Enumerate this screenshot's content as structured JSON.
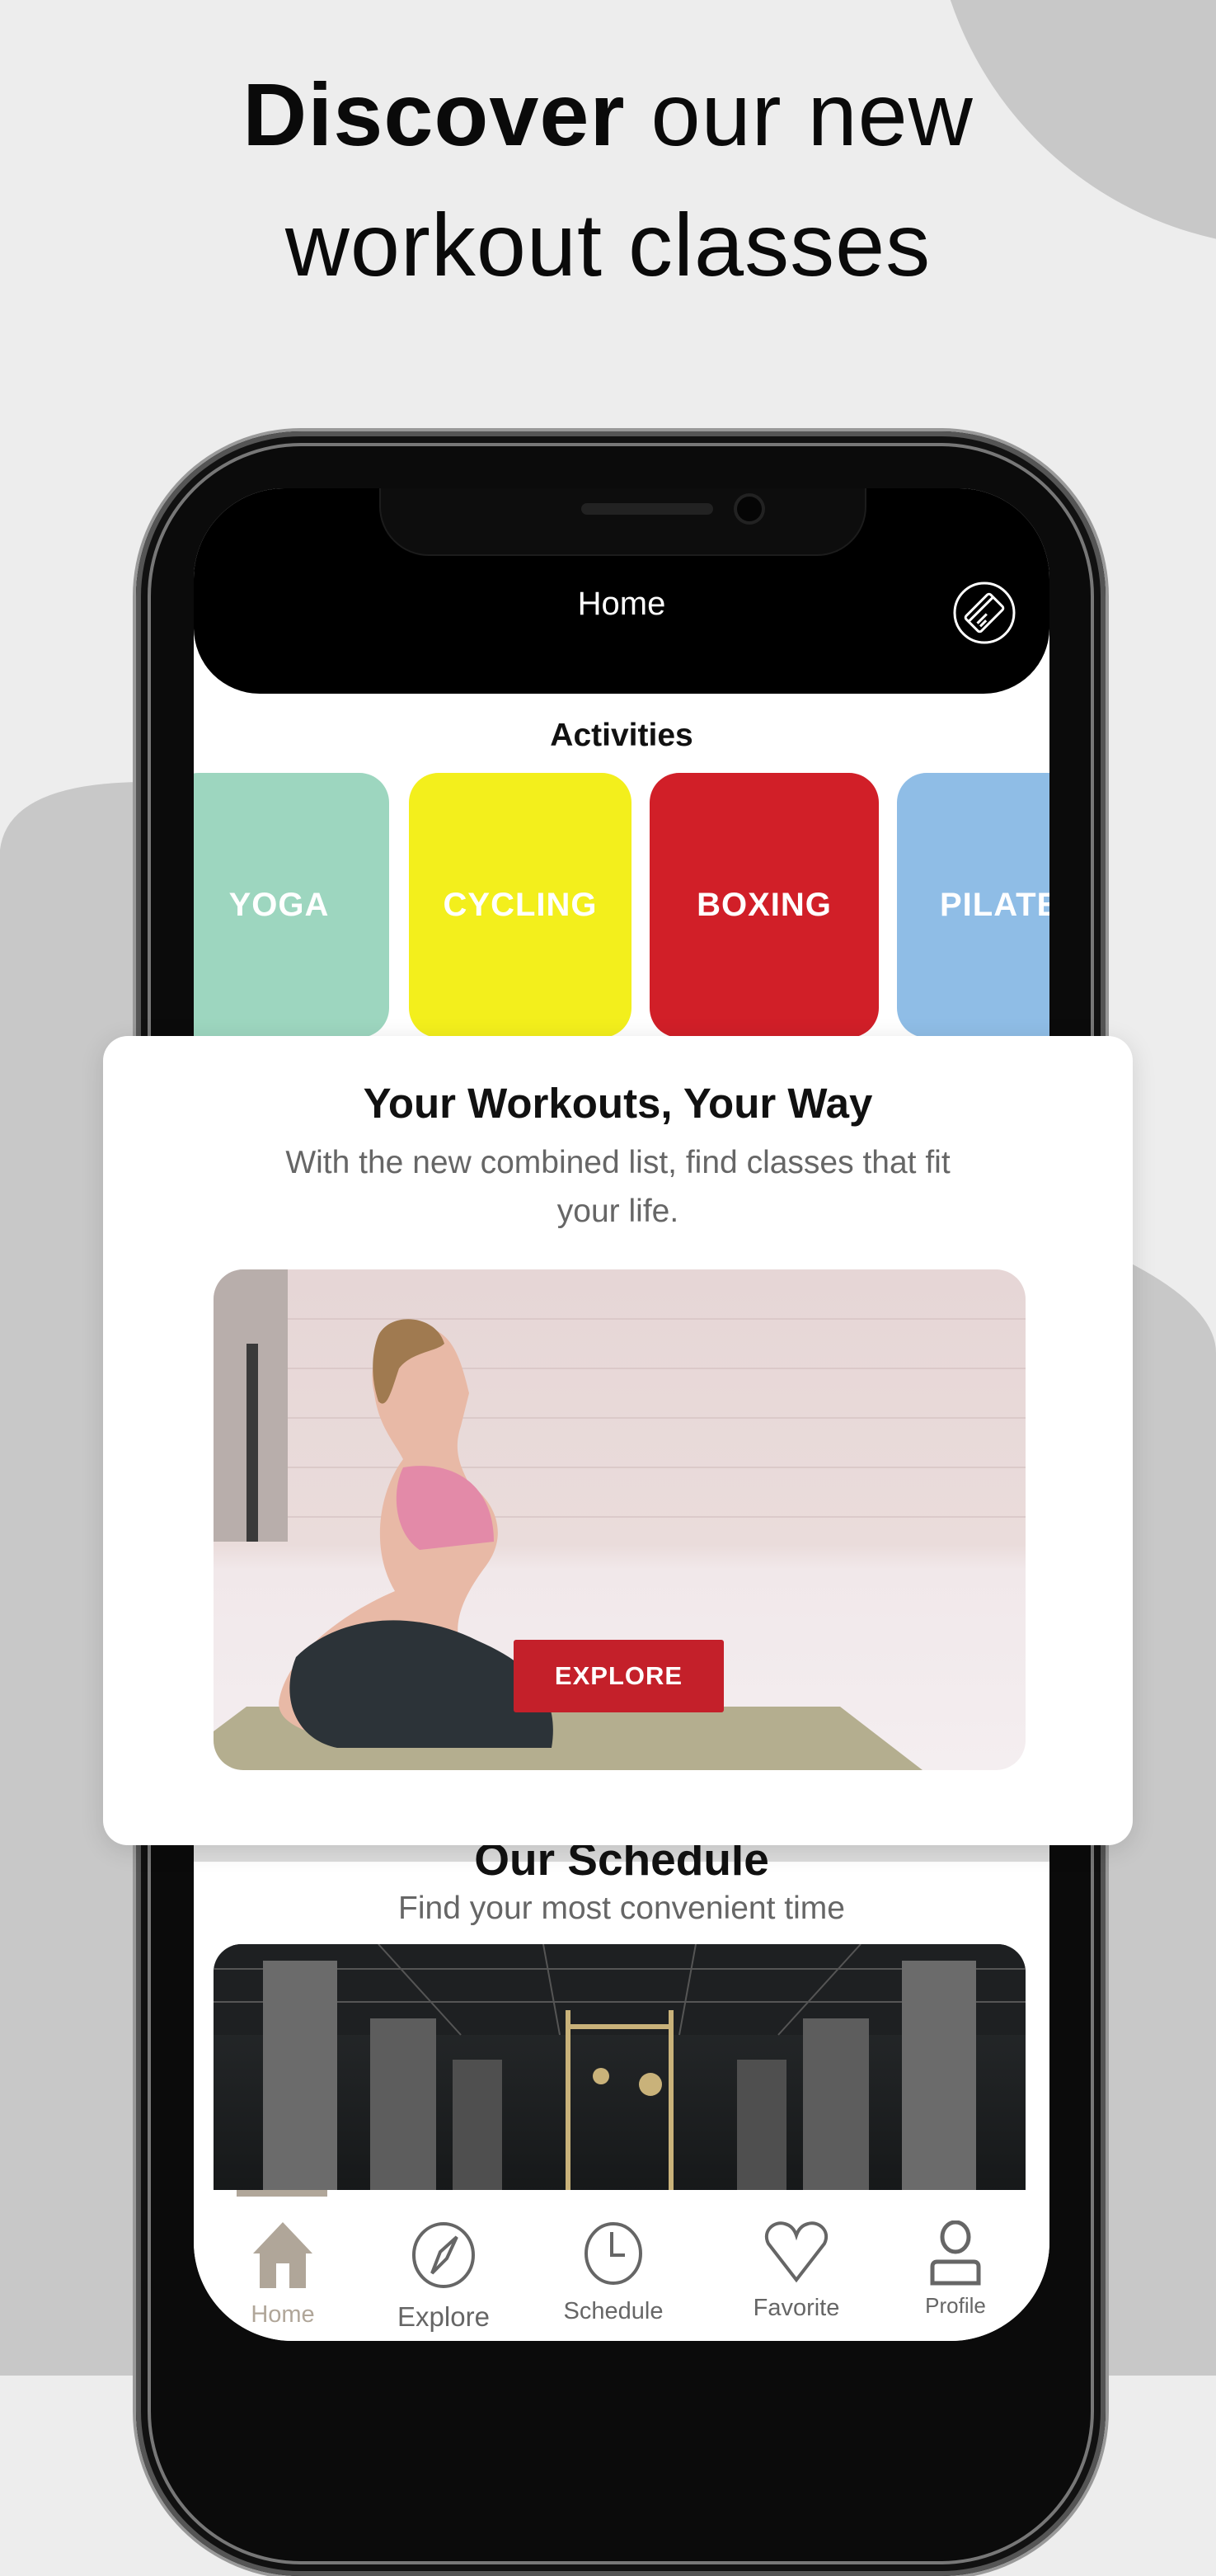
{
  "headline": {
    "bold": "Discover",
    "rest_line1": " our new",
    "line2": "workout classes"
  },
  "app": {
    "header": {
      "title": "Home",
      "icon": "membership-card-icon"
    },
    "activities": {
      "title": "Activities",
      "items": [
        {
          "label": "YOGA",
          "color": "#9dd6bf"
        },
        {
          "label": "CYCLING",
          "color": "#f3ef1c"
        },
        {
          "label": "BOXING",
          "color": "#d11f28"
        },
        {
          "label": "PILATES",
          "color": "#8fbde6"
        }
      ]
    },
    "schedule": {
      "title": "Our Schedule",
      "subtitle": "Find your most convenient time"
    },
    "tabs": [
      {
        "label": "Home",
        "icon": "home-icon",
        "active": true
      },
      {
        "label": "Explore",
        "icon": "compass-icon"
      },
      {
        "label": "Schedule",
        "icon": "clock-icon"
      },
      {
        "label": "Favorite",
        "icon": "heart-icon"
      },
      {
        "label": "Profile",
        "icon": "person-icon"
      }
    ]
  },
  "card": {
    "title": "Your Workouts, Your Way",
    "subtitle": "With the new combined list, find classes that fit your life.",
    "button": "EXPLORE",
    "button_color": "#c4202a"
  },
  "colors": {
    "background": "#ededed",
    "shape": "#c8c8c8",
    "tab_active": "#b0a699",
    "tab_inactive": "#666666"
  }
}
